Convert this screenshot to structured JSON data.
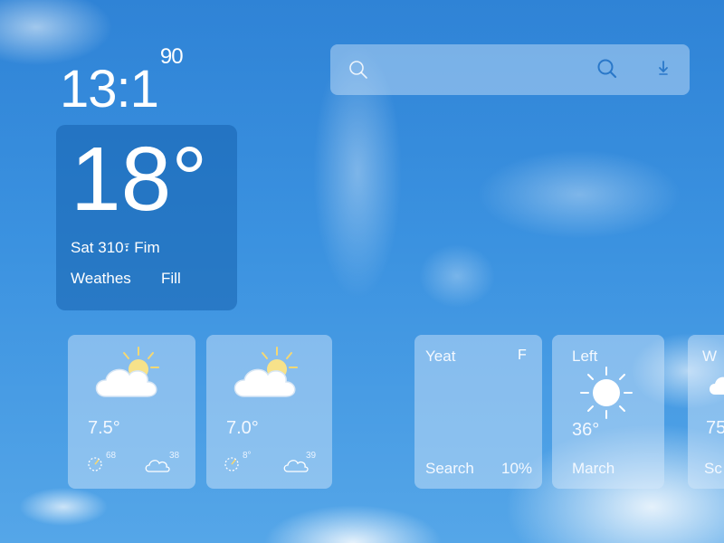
{
  "clock": {
    "time": "13:1",
    "suffix": "90"
  },
  "current": {
    "temperature": "18°",
    "date_line": "Sat 310፣ Fim",
    "condition": "Weathes",
    "extra": "Fill"
  },
  "search": {
    "placeholder": ""
  },
  "forecast_cards": [
    {
      "icon": "partly-cloudy-icon",
      "temp": "7.5°",
      "stat_a": "68",
      "stat_b": "38"
    },
    {
      "icon": "partly-cloudy-icon",
      "temp": "7.0°",
      "stat_a": "8°",
      "stat_b": "39"
    }
  ],
  "info_cards": [
    {
      "title": "Yeat",
      "badge": "F",
      "left_label": "Search",
      "right_label": "10%"
    },
    {
      "title": "Left",
      "icon": "sun-icon",
      "temp": "36°",
      "foot": "March"
    },
    {
      "title": "W",
      "temp": "75",
      "foot": "Sc"
    }
  ]
}
